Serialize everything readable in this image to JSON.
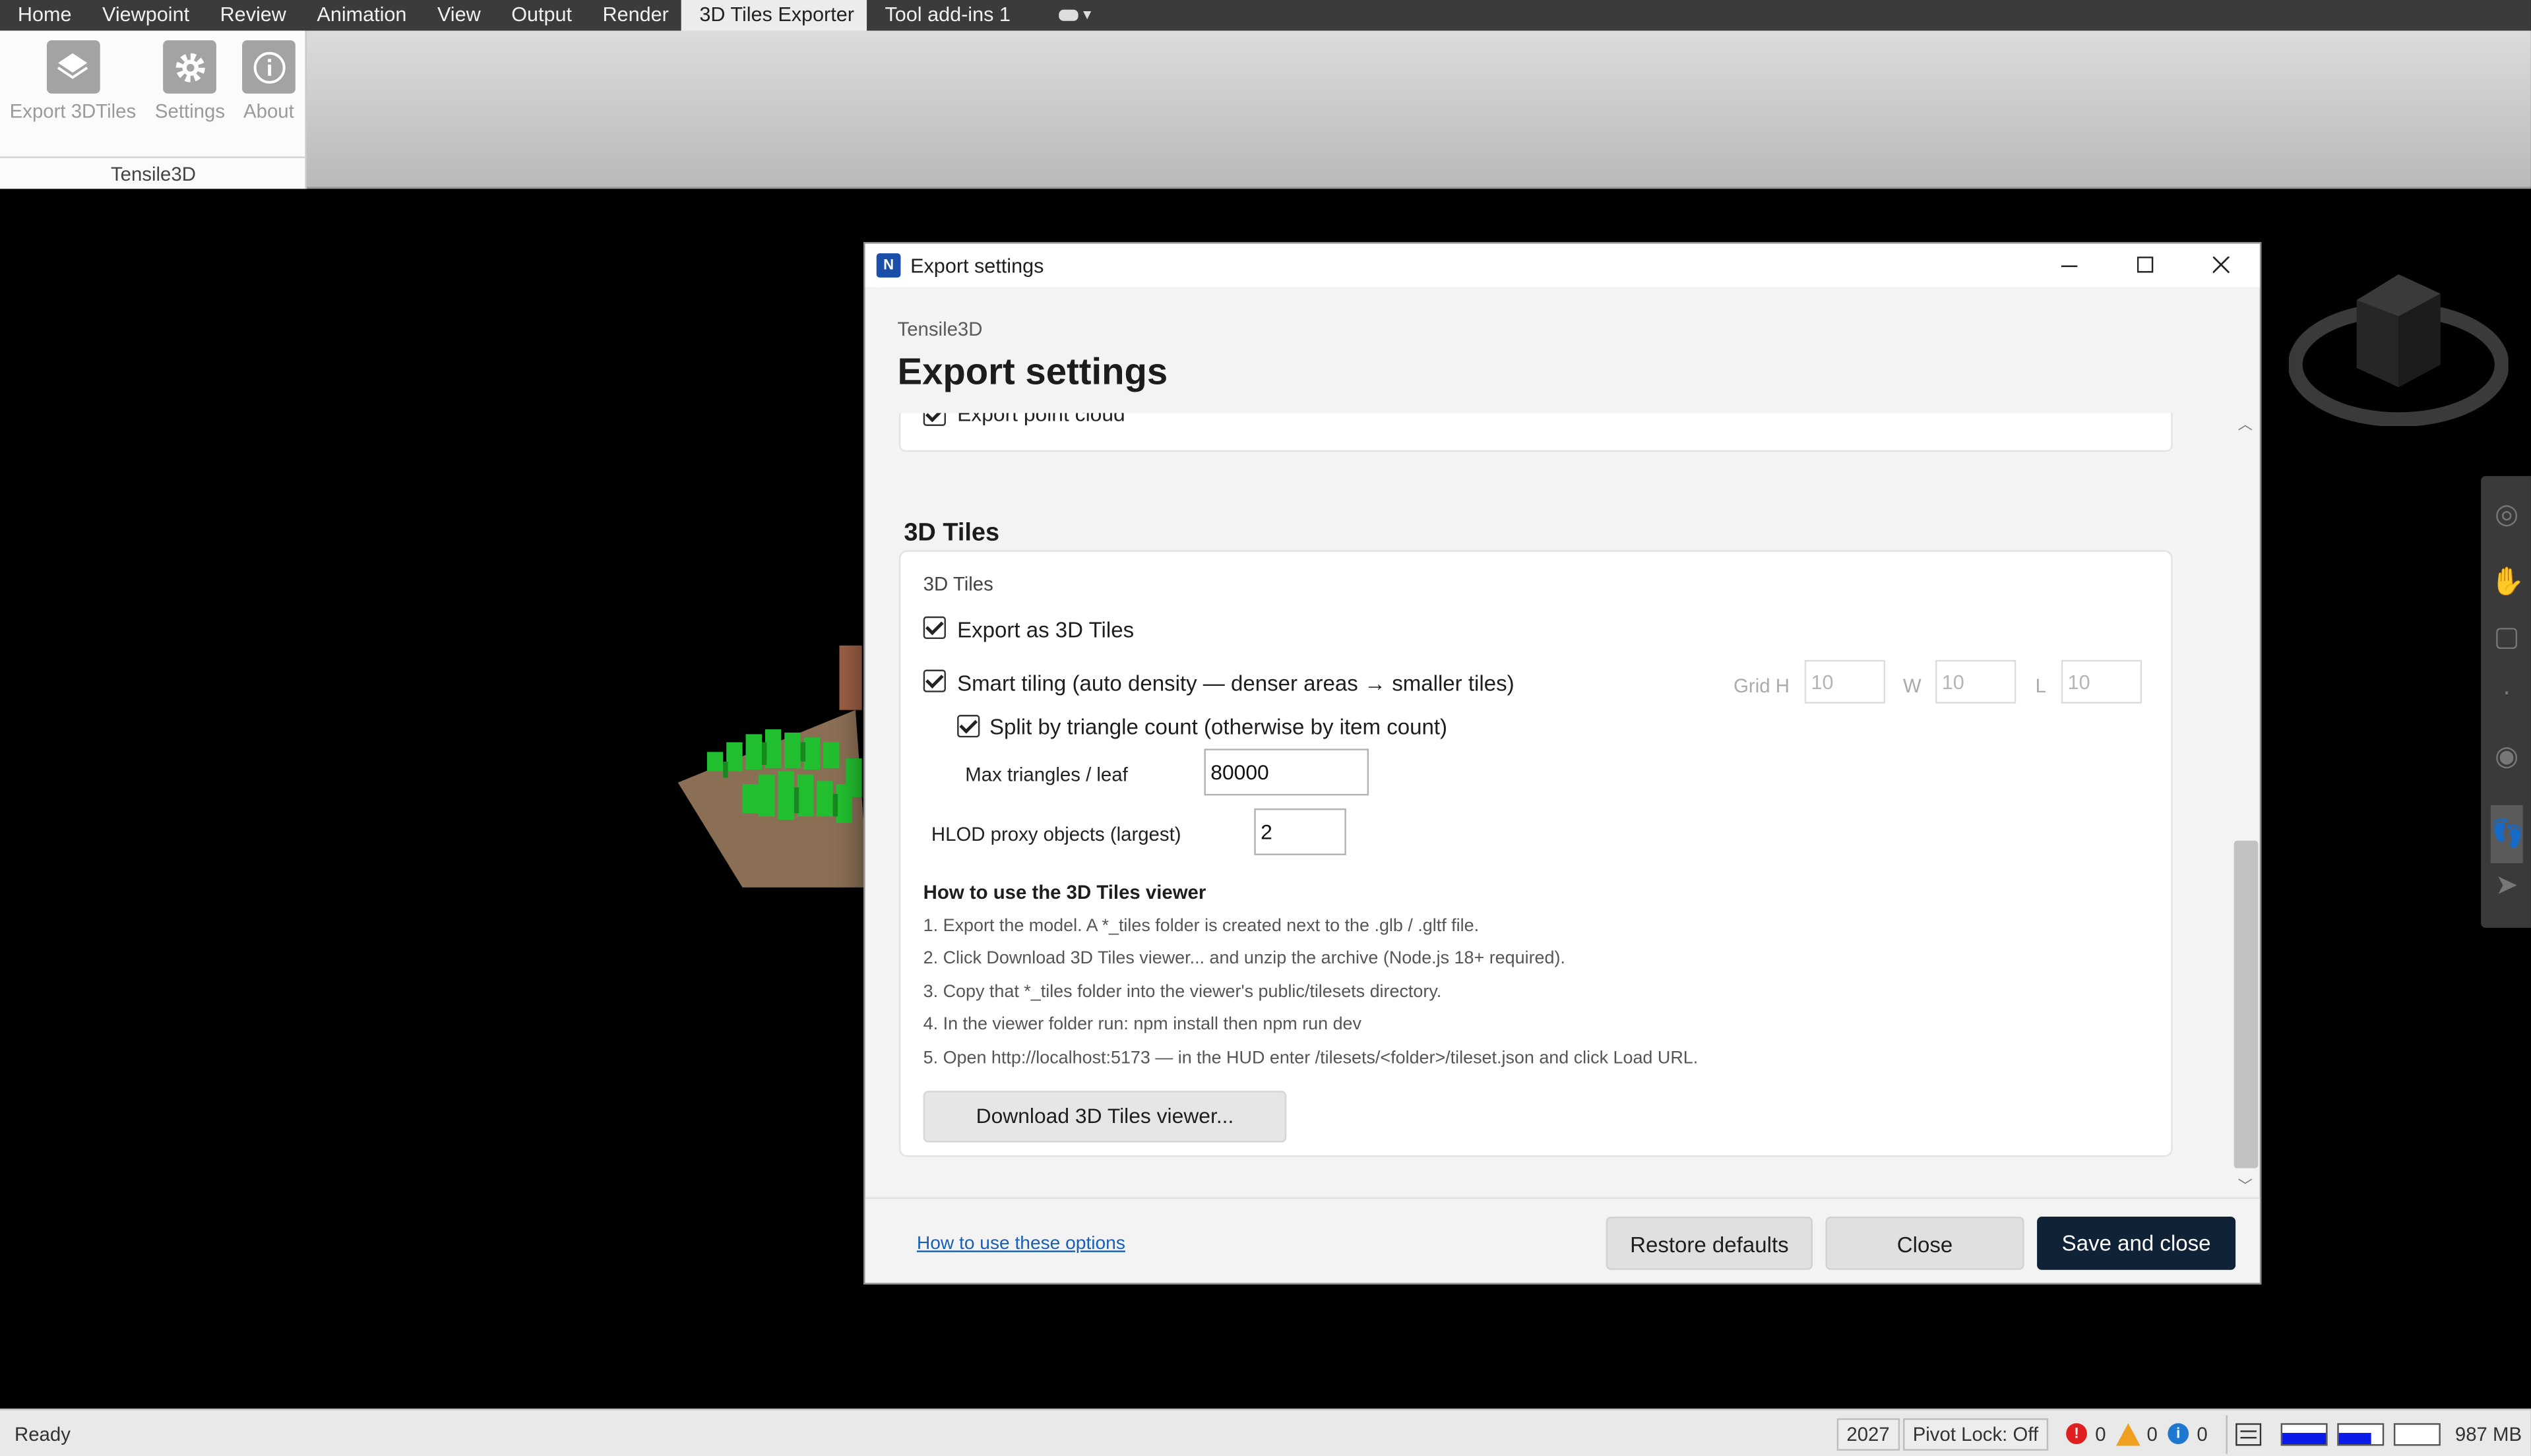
{
  "menu": {
    "items": [
      "Home",
      "Viewpoint",
      "Review",
      "Animation",
      "View",
      "Output",
      "Render",
      "3D Tiles Exporter",
      "Tool add-ins 1"
    ],
    "active_index": 7
  },
  "ribbon": {
    "buttons": [
      {
        "label": "Export 3DTiles",
        "icon": "cube-export-icon"
      },
      {
        "label": "Settings",
        "icon": "gear-icon"
      },
      {
        "label": "About",
        "icon": "info-icon"
      }
    ],
    "group_label": "Tensile3D"
  },
  "dialog": {
    "window_title": "Export settings",
    "app_icon_letter": "N",
    "header_sub": "Tensile3D",
    "header_title": "Export settings",
    "previous_option": "Export point cloud",
    "section_title": "3D Tiles",
    "card_heading": "3D Tiles",
    "export_as_3d_tiles": {
      "label": "Export as 3D Tiles",
      "checked": true
    },
    "smart_tiling": {
      "label": "Smart tiling (auto density — denser areas → smaller tiles)",
      "checked": true
    },
    "grid": {
      "h_label": "Grid H",
      "h_value": "10",
      "w_label": "W",
      "w_value": "10",
      "l_label": "L",
      "l_value": "10"
    },
    "split_by_triangle": {
      "label": "Split by triangle count (otherwise by item count)",
      "checked": true
    },
    "max_triangles": {
      "label": "Max triangles / leaf",
      "value": "80000"
    },
    "hlod_proxy": {
      "label": "HLOD proxy objects (largest)",
      "value": "2"
    },
    "how_to": {
      "title": "How to use the 3D Tiles viewer",
      "steps": [
        "1. Export the model. A *_tiles folder is created next to the .glb / .gltf file.",
        "2. Click Download 3D Tiles viewer... and unzip the archive (Node.js 18+ required).",
        "3. Copy that *_tiles folder into the viewer's public/tilesets directory.",
        "4. In the viewer folder run:  npm install   then   npm run dev",
        "5. Open http://localhost:5173 — in the HUD enter /tilesets/<folder>/tileset.json and click Load URL."
      ]
    },
    "download_button": "Download 3D Tiles viewer...",
    "footer": {
      "help_link": "How to use these options",
      "restore_button": "Restore defaults",
      "close_button": "Close",
      "save_button": "Save and close"
    }
  },
  "statusbar": {
    "status": "Ready",
    "year": "2027",
    "pivot_lock": "Pivot Lock: Off",
    "errors": "0",
    "warnings": "0",
    "infos": "0",
    "memory": "987 MB"
  },
  "colors": {
    "primary_button": "#0f2236",
    "link": "#1a5fb4",
    "error": "#e02020",
    "warning": "#f0a020",
    "info": "#1e78d0",
    "meter_fill": "#0a1ae8"
  }
}
